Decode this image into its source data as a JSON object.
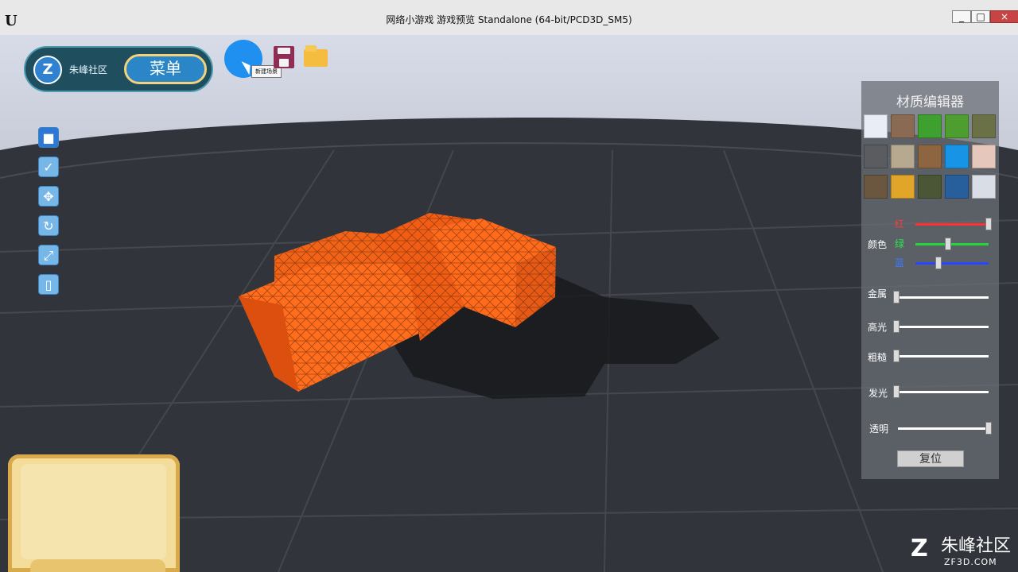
{
  "window": {
    "title": "网络小游戏 游戏预览 Standalone (64-bit/PCD3D_SM5)",
    "app_icon_name": "unreal-engine-logo-icon",
    "controls": [
      "minimize-icon",
      "maximize-icon",
      "close-icon"
    ]
  },
  "hud": {
    "logo_text": "朱峰社区",
    "menu_label": "菜单",
    "tooltip": "新建场景",
    "top_icons": [
      "new-scene-icon",
      "save-icon",
      "folder-icon"
    ],
    "left_tools": [
      "cube-icon",
      "checkbox-icon",
      "move-icon",
      "rotate-icon",
      "scale-icon",
      "delete-icon"
    ]
  },
  "material_editor": {
    "title": "材质编辑器",
    "color_label": "颜色",
    "color_channels": [
      {
        "label": "红",
        "value": 1.0
      },
      {
        "label": "绿",
        "value": 0.45
      },
      {
        "label": "蓝",
        "value": 0.32
      }
    ],
    "sliders": [
      {
        "label": "金属",
        "value": 0.0
      },
      {
        "label": "高光",
        "value": 0.0
      },
      {
        "label": "粗糙",
        "value": 0.0
      },
      {
        "label": "发光",
        "value": 0.0
      },
      {
        "label": "透明",
        "value": 1.0
      }
    ],
    "reset_label": "复位"
  },
  "watermark": {
    "text": "朱峰社区",
    "subtext": "ZF3D.COM"
  },
  "colors": {
    "orange": "#ff6a12",
    "panel": "#6b6f76",
    "menu_blue": "#2a86c7"
  }
}
